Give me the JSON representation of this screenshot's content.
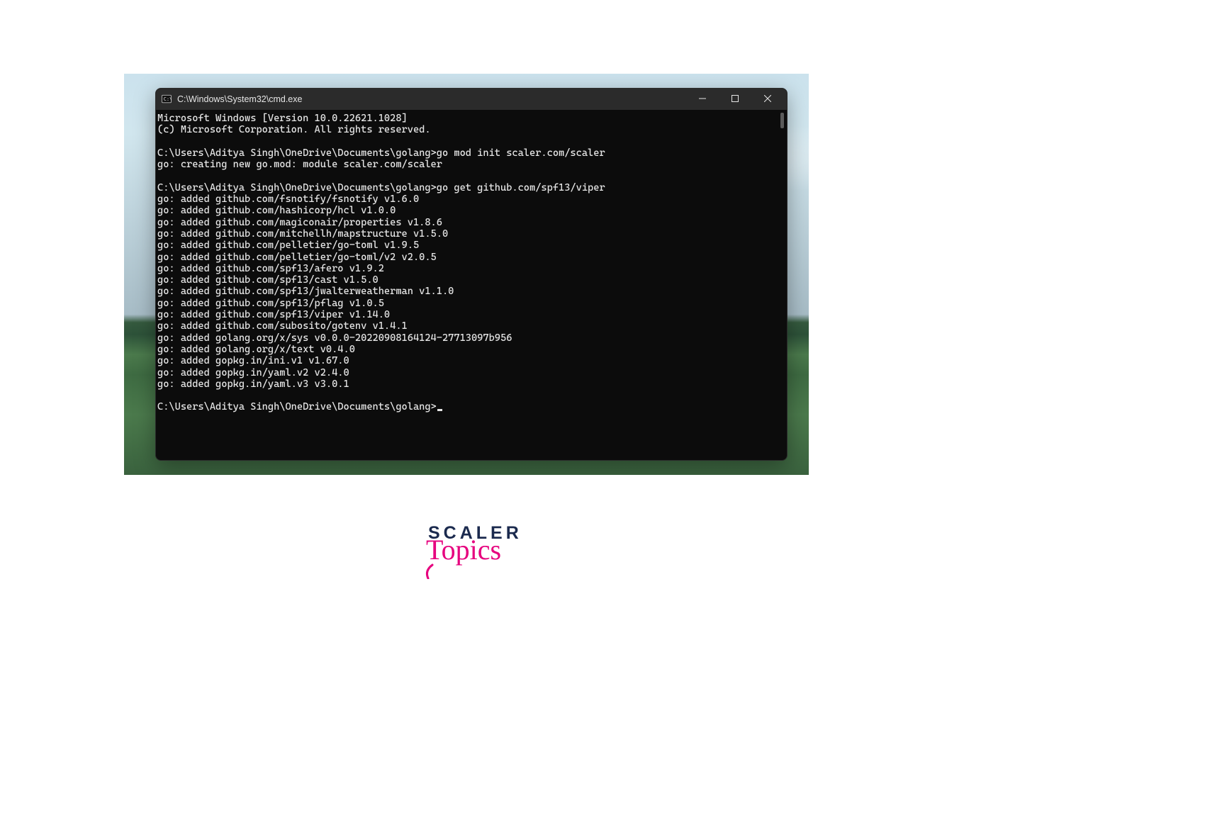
{
  "window": {
    "title": "C:\\Windows\\System32\\cmd.exe"
  },
  "terminal": {
    "banner": [
      "Microsoft Windows [Version 10.0.22621.1028]",
      "(c) Microsoft Corporation. All rights reserved."
    ],
    "sessions": [
      {
        "prompt": "C:\\Users\\Aditya Singh\\OneDrive\\Documents\\golang>",
        "command": "go mod init scaler.com/scaler",
        "output": [
          "go: creating new go.mod: module scaler.com/scaler"
        ]
      },
      {
        "prompt": "C:\\Users\\Aditya Singh\\OneDrive\\Documents\\golang>",
        "command": "go get github.com/spf13/viper",
        "output": [
          "go: added github.com/fsnotify/fsnotify v1.6.0",
          "go: added github.com/hashicorp/hcl v1.0.0",
          "go: added github.com/magiconair/properties v1.8.6",
          "go: added github.com/mitchellh/mapstructure v1.5.0",
          "go: added github.com/pelletier/go-toml v1.9.5",
          "go: added github.com/pelletier/go-toml/v2 v2.0.5",
          "go: added github.com/spf13/afero v1.9.2",
          "go: added github.com/spf13/cast v1.5.0",
          "go: added github.com/spf13/jwalterweatherman v1.1.0",
          "go: added github.com/spf13/pflag v1.0.5",
          "go: added github.com/spf13/viper v1.14.0",
          "go: added github.com/subosito/gotenv v1.4.1",
          "go: added golang.org/x/sys v0.0.0-20220908164124-27713097b956",
          "go: added golang.org/x/text v0.4.0",
          "go: added gopkg.in/ini.v1 v1.67.0",
          "go: added gopkg.in/yaml.v2 v2.4.0",
          "go: added gopkg.in/yaml.v3 v3.0.1"
        ]
      }
    ],
    "trailing_prompt": "C:\\Users\\Aditya Singh\\OneDrive\\Documents\\golang>"
  },
  "logo": {
    "line1": "SCALER",
    "line2": "Topics"
  }
}
